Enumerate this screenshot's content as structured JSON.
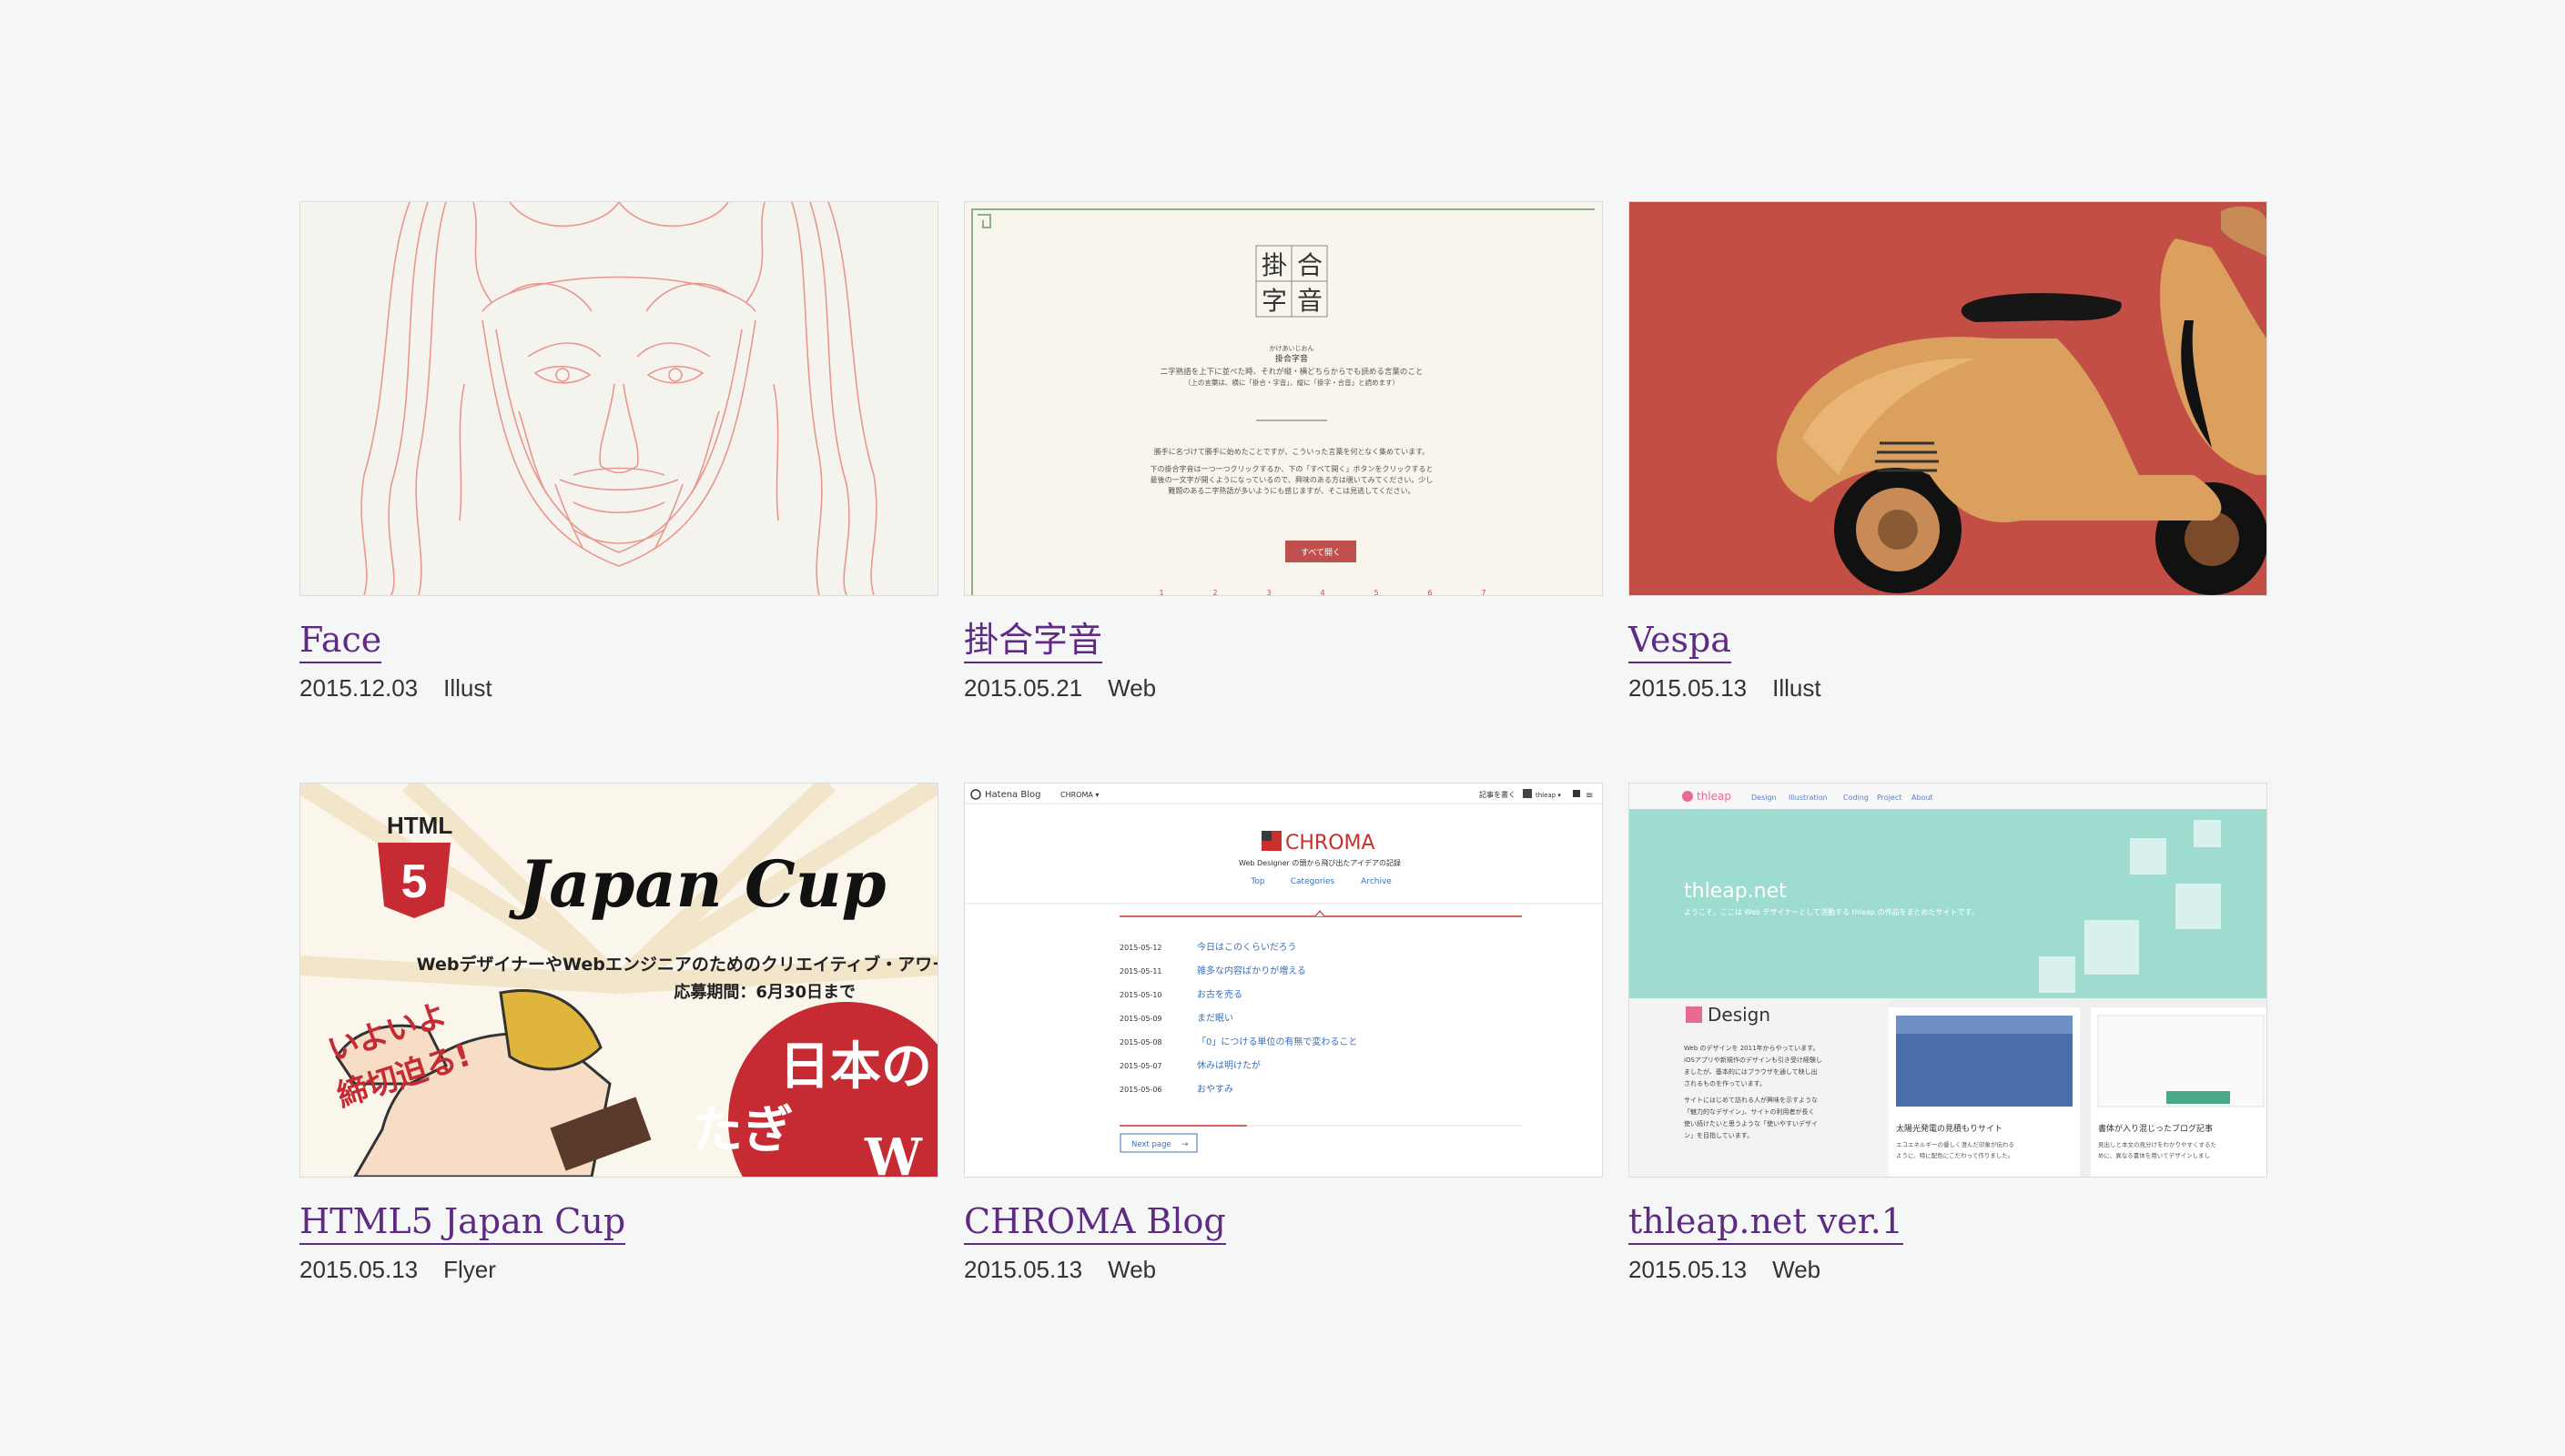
{
  "works": [
    {
      "title": "Face",
      "date": "2015.12.03",
      "category": "Illust"
    },
    {
      "title": "掛合字音",
      "date": "2015.05.21",
      "category": "Web",
      "thumb": {
        "logo": [
          "掛",
          "合",
          "字",
          "音"
        ],
        "ruby": "かけあいじおん",
        "name": "掛合字音",
        "desc1": "二字熟語を上下に並べた時、それが縦・横どちらからでも読める言葉のこと",
        "desc2": "（上の言葉は、横に「掛合・字音」、縦に「掛字・合音」と読めます）",
        "body1": "勝手に名づけて勝手に始めたことですが、こういった言葉を何となく集めています。",
        "body2": "下の掛合字音は一つ一つクリックするか、下の「すべて開く」ボタンをクリックすると",
        "body3": "最後の一文字が開くようになっているので、興味のある方は覗いてみてください。少し",
        "body4": "難題のある二字熟語が多いようにも感じますが、そこは見逃してください。",
        "button": "すべて開く",
        "pages": [
          "1",
          "2",
          "3",
          "4",
          "5",
          "6",
          "7"
        ]
      }
    },
    {
      "title": "Vespa",
      "date": "2015.05.13",
      "category": "Illust"
    },
    {
      "title": "HTML5 Japan Cup",
      "date": "2015.05.13",
      "category": "Flyer",
      "thumb": {
        "html": "HTML",
        "five": "5",
        "cup": "Japan Cup",
        "sub": "WebデザイナーやWebエンジニアのためのクリエイティブ・アワード",
        "deadline": "応募期間：6月30日まで",
        "slogan1": "いよいよ",
        "slogan2": "締切迫る!",
        "circle1": "日本の",
        "circle2": "たぎ",
        "circle3": "W"
      }
    },
    {
      "title": "CHROMA Blog",
      "date": "2015.05.13",
      "category": "Web",
      "thumb": {
        "brand": "Hatena Blog",
        "menu": "CHROMA ▾",
        "write": "記事を書く",
        "user": "thleap ▾",
        "logo": "CHROMA",
        "tagline": "Web Designer の頭から飛び出たアイデアの記録",
        "nav": [
          "Top",
          "Categories",
          "Archive"
        ],
        "posts": [
          {
            "date": "2015-05-12",
            "title": "今日はこのくらいだろう"
          },
          {
            "date": "2015-05-11",
            "title": "雑多な内容ばかりが増える"
          },
          {
            "date": "2015-05-10",
            "title": "お古を売る"
          },
          {
            "date": "2015-05-09",
            "title": "まだ眠い"
          },
          {
            "date": "2015-05-08",
            "title": "「0」につける単位の有無で変わること"
          },
          {
            "date": "2015-05-07",
            "title": "休みは明けたが"
          },
          {
            "date": "2015-05-06",
            "title": "おやすみ"
          }
        ],
        "next": "Next page"
      }
    },
    {
      "title": "thleap.net ver.1",
      "date": "2015.05.13",
      "category": "Web",
      "thumb": {
        "brand": "thleap",
        "nav": [
          "Design",
          "Illustration",
          "Coding",
          "Project",
          "About"
        ],
        "hero": "thleap.net",
        "hero_sub": "ようこそ。ここは Web デザイナーとして活動する thleap の作品をまとめたサイトです。",
        "section": "Design",
        "text1": "Web のデザインを 2011年からやっています。",
        "text2": "iOSアプリや新規作のデザインも引き受け経験し",
        "text3": "ましたが、基本的にはブラウザを通して映し出",
        "text4": "されるものを作っています。",
        "text5": "サイトにはじめて訪れる人が興味を示すような",
        "text6": "「魅力的なデザイン」、サイトの利用者が長く",
        "text7": "使い続けたいと思うような「使いやすいデザイ",
        "text8": "ン」を目指しています。",
        "card1_title": "太陽光発電の見積もりサイト",
        "card1_text": "エコエネルギーの優しく澄んだ印象が伝わる",
        "card1_text2": "ように、特に配色にこだわって作りました。",
        "card2_title": "書体が入り混じったブログ記事",
        "card2_text": "見出しと本文の見分けをわかりやすくするた",
        "card2_text2": "めに、異なる書体を用いてデザインしまし"
      }
    }
  ],
  "colors": {
    "link": "#5e2a84",
    "vespa_bg": "#c24e46",
    "scooter": "#dba05d",
    "face_line": "#e6877e",
    "kake_bg": "#f8f6ec",
    "kake_btn": "#c0504d",
    "chroma_red": "#c9302c",
    "chroma_link": "#3c6fb5",
    "thleap_mint": "#8fd8cc"
  }
}
